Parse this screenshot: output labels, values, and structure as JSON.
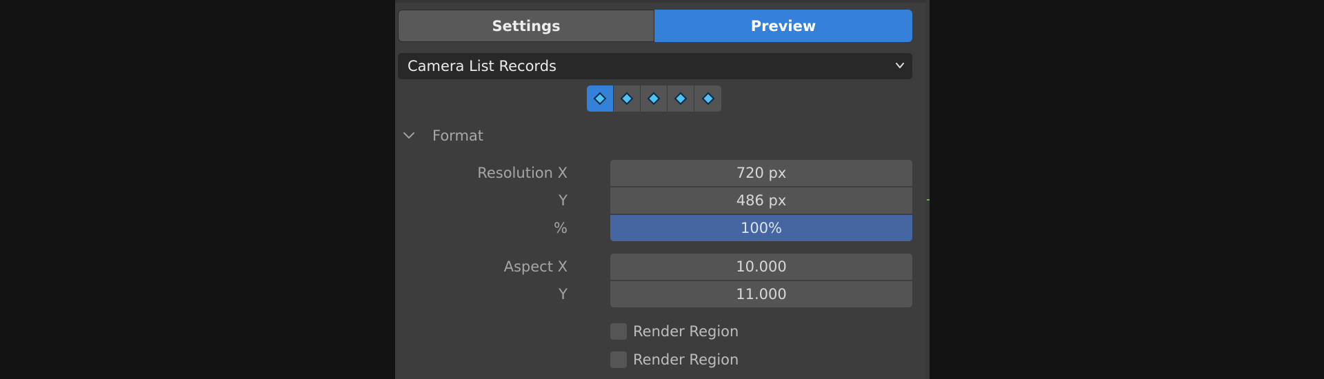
{
  "tabs": [
    {
      "label": "Settings",
      "active": false
    },
    {
      "label": "Preview",
      "active": true
    }
  ],
  "dropdown": {
    "selected": "Camera List Records"
  },
  "keyframe_buttons": [
    {
      "icon": "keyframe-diamond-icon",
      "active": true
    },
    {
      "icon": "keyframe-diamond-icon",
      "active": false
    },
    {
      "icon": "keyframe-diamond-icon",
      "active": false
    },
    {
      "icon": "keyframe-diamond-icon",
      "active": false
    },
    {
      "icon": "keyframe-diamond-icon",
      "active": false
    }
  ],
  "format": {
    "title": "Format",
    "resolution_x_label": "Resolution X",
    "resolution_x_value": "720 px",
    "resolution_y_label": "Y",
    "resolution_y_value": "486 px",
    "percent_label": "%",
    "percent_value": "100%",
    "aspect_x_label": "Aspect X",
    "aspect_x_value": "10.000",
    "aspect_y_label": "Y",
    "aspect_y_value": "11.000"
  },
  "checkboxes": [
    {
      "label": "Render Region",
      "checked": false
    },
    {
      "label": "Render Region",
      "checked": false
    }
  ],
  "colors": {
    "accent": "#3580d8",
    "slider_fill": "#4566a0",
    "panel_bg": "#3d3d3d",
    "keyframe_diamond": "#4fc3f7"
  }
}
